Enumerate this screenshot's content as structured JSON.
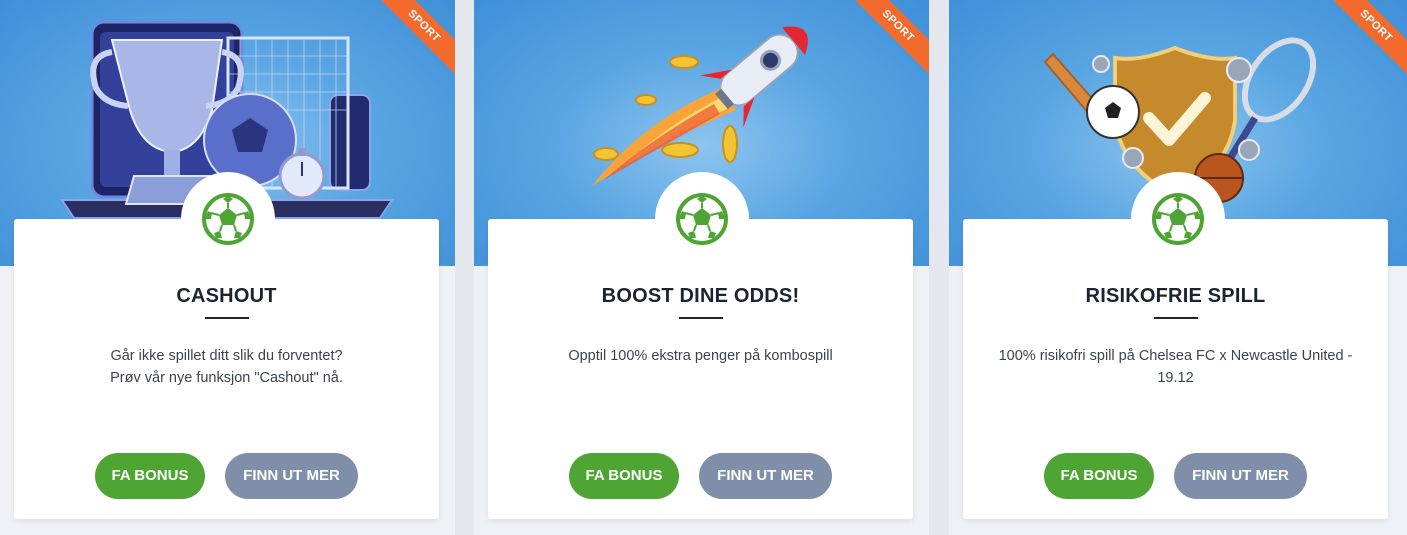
{
  "colors": {
    "hero_blue": "#5aa6e3",
    "ribbon_orange": "#f26a2c",
    "bonus_green": "#4ea534",
    "more_gray_blue": "#7f8faa",
    "title_dark": "#1b2430"
  },
  "promos": [
    {
      "ribbon": "SPORT",
      "illustration_icon": "trophy-football-icon",
      "badge_icon": "soccer-ball-icon",
      "title": "CASHOUT",
      "description_line1": "Går ikke spillet ditt slik du forventet?",
      "description_line2": "Prøv vår nye funksjon \"Cashout\" nå.",
      "bonus_label": "FA BONUS",
      "more_label": "FINN UT MER"
    },
    {
      "ribbon": "SPORT",
      "illustration_icon": "rocket-coins-icon",
      "badge_icon": "soccer-ball-icon",
      "title": "BOOST DINE ODDS!",
      "description_line1": "Opptil 100% ekstra penger på kombospill",
      "description_line2": "",
      "bonus_label": "FA BONUS",
      "more_label": "FINN UT MER"
    },
    {
      "ribbon": "SPORT",
      "illustration_icon": "shield-sports-icon",
      "badge_icon": "soccer-ball-icon",
      "title": "RISIKOFRIE SPILL",
      "description_line1": "100% risikofri spill på Chelsea FC x Newcastle United -",
      "description_line2": "19.12",
      "bonus_label": "FA BONUS",
      "more_label": "FINN UT MER"
    }
  ]
}
